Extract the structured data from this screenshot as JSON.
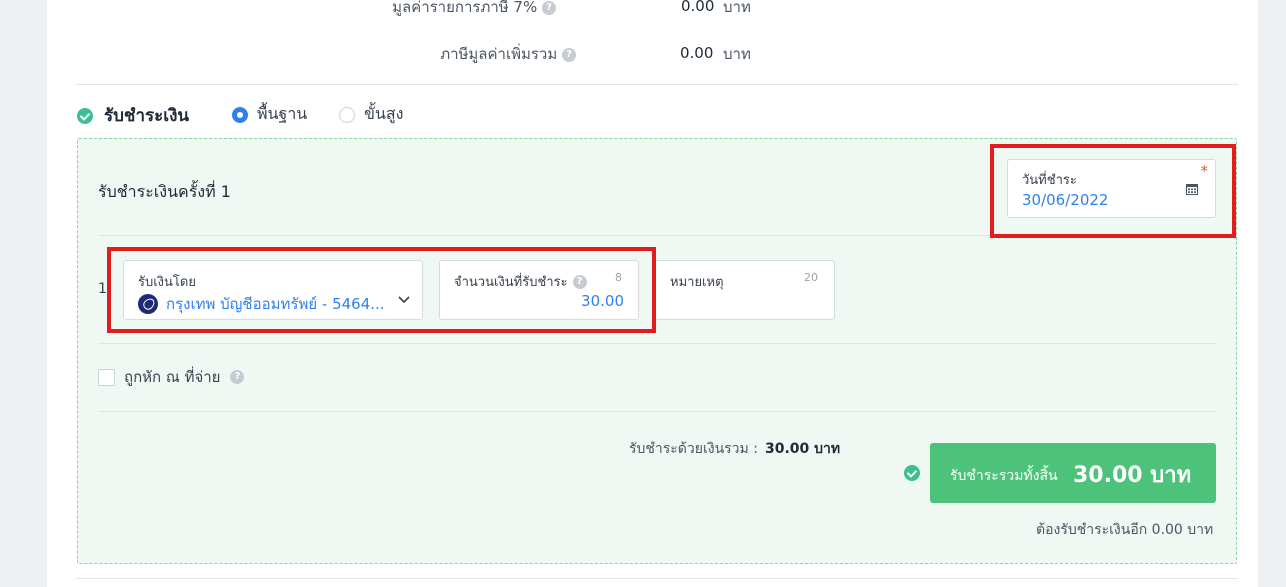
{
  "vat_section": {
    "vat7_label": "มูลค่ารายการภาษี 7%",
    "vat7_value": "0.00",
    "vat7_unit": "บาท",
    "vat_total_label": "ภาษีมูลค่าเพิ่มรวม",
    "vat_total_value": "0.00",
    "vat_total_unit": "บาท"
  },
  "payment": {
    "section_label": "รับชำระเงิน",
    "mode_basic": "พื้นฐาน",
    "mode_advanced": "ขั้นสูง",
    "installment_title": "รับชำระเงินครั้งที่ 1",
    "date_label": "วันที่ชำระ",
    "date_required_mark": "*",
    "date_value": "30/06/2022",
    "row_index": "1",
    "method_label": "รับเงินโดย",
    "method_value": "กรุงเทพ บัญชีออมทรัพย์ - 5464...",
    "amount_label": "จำนวนเงินที่รับชำระ",
    "amount_count": "8",
    "amount_value": "30.00",
    "note_label": "หมายเหตุ",
    "note_count": "20",
    "withholding_label": "ถูกหัก ณ ที่จ่าย",
    "paid_total_label": "รับชำระด้วยเงินรวม :",
    "paid_total_value": "30.00 บาท",
    "grand_total_label": "รับชำระรวมทั้งสิ้น",
    "grand_total_value": "30.00 บาท",
    "remaining_text": "ต้องรับชำระเงินอีก 0.00 บาท"
  },
  "colors": {
    "accent_blue": "#2f80ed",
    "success_green": "#4cc27a",
    "panel_green": "#eff8f2",
    "highlight_red": "#e11d1d"
  }
}
